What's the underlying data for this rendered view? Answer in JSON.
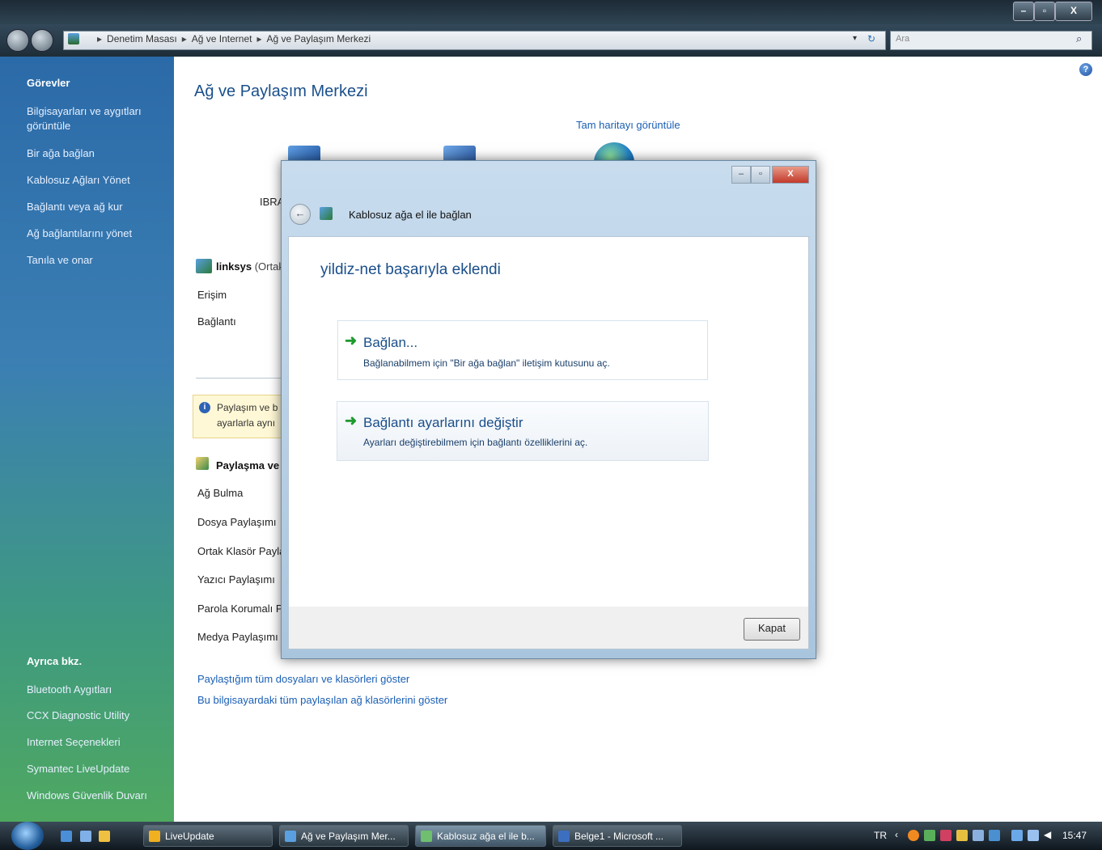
{
  "window": {
    "controls": {
      "minimize": "–",
      "maximize": "▫",
      "close": "X"
    }
  },
  "address": {
    "crumbs": [
      "Denetim Masası",
      "Ağ ve Internet",
      "Ağ ve Paylaşım Merkezi"
    ],
    "search_placeholder": "Ara"
  },
  "sidebar": {
    "tasks_heading": "Görevler",
    "tasks": [
      "Bilgisayarları ve aygıtları görüntüle",
      "Bir ağa bağlan",
      "Kablosuz Ağları Yönet",
      "Bağlantı veya ağ kur",
      "Ağ bağlantılarını yönet",
      "Tanıla ve onar"
    ],
    "see_also_heading": "Ayrıca bkz.",
    "see_also": [
      "Bluetooth Aygıtları",
      "CCX Diagnostic Utility",
      "Internet Seçenekleri",
      "Symantec LiveUpdate",
      "Windows Güvenlik Duvarı"
    ]
  },
  "main": {
    "title": "Ağ ve Paylaşım Merkezi",
    "map_link": "Tam haritayı görüntüle",
    "computer_label": "IBRA",
    "network_name": "linksys",
    "network_type": "(Ortak",
    "access_label": "Erişim",
    "connection_label": "Bağlantı",
    "info_text_1": "Paylaşım ve b",
    "info_text_2": "ayarlarla aynı",
    "sharing_heading": "Paylaşma ve B",
    "sharing_rows": [
      "Ağ Bulma",
      "Dosya Paylaşımı",
      "Ortak Klasör Payla",
      "Yazıcı Paylaşımı",
      "Parola Korumalı Pa",
      "Medya Paylaşımı"
    ],
    "bottom_links": [
      "Paylaştığım tüm dosyaları ve klasörleri göster",
      "Bu bilgisayardaki tüm paylaşılan ağ klasörlerini göster"
    ]
  },
  "dialog": {
    "title": "Kablosuz ağa el ile bağlan",
    "heading": "yildiz-net başarıyla eklendi",
    "options": [
      {
        "title": "Bağlan...",
        "subtitle": "Bağlanabilmem için \"Bir ağa bağlan\" iletişim kutusunu aç."
      },
      {
        "title": "Bağlantı ayarlarını değiştir",
        "subtitle": "Ayarları değiştirebilmem için bağlantı özelliklerini aç."
      }
    ],
    "close_button": "Kapat"
  },
  "taskbar": {
    "buttons": [
      "LiveUpdate",
      "Ağ ve Paylaşım Mer...",
      "Kablosuz ağa el ile b...",
      "Belge1 - Microsoft ..."
    ],
    "language": "TR",
    "clock": "15:47"
  }
}
